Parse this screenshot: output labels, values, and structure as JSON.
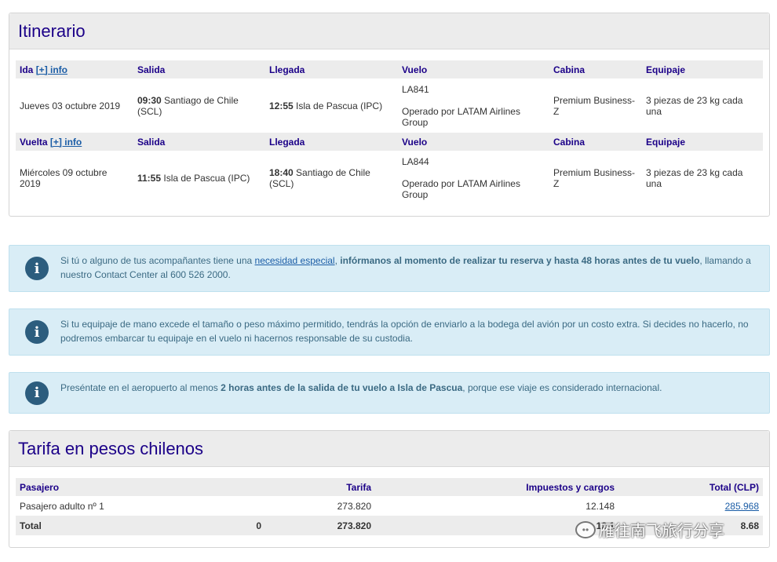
{
  "itinerary": {
    "title": "Itinerario",
    "headers": {
      "salida": "Salida",
      "llegada": "Llegada",
      "vuelo": "Vuelo",
      "cabina": "Cabina",
      "equipaje": "Equipaje"
    },
    "info_link": "[+] info",
    "ida": {
      "label": "Ida",
      "date": "Jueves 03 octubre 2019",
      "dep_time": "09:30",
      "dep_place": "Santiago de Chile (SCL)",
      "arr_time": "12:55",
      "arr_place": "Isla de Pascua (IPC)",
      "flight": "LA841",
      "operated": "Operado por LATAM Airlines Group",
      "cabin": "Premium Business-Z",
      "baggage": "3 piezas de 23 kg cada una"
    },
    "vuelta": {
      "label": "Vuelta",
      "date": "Miércoles 09 octubre 2019",
      "dep_time": "11:55",
      "dep_place": "Isla de Pascua (IPC)",
      "arr_time": "18:40",
      "arr_place": "Santiago de Chile (SCL)",
      "flight": "LA844",
      "operated": "Operado por LATAM Airlines Group",
      "cabin": "Premium Business-Z",
      "baggage": "3 piezas de 23 kg cada una"
    }
  },
  "alerts": {
    "icon": "info-icon",
    "a1": {
      "pre": "Si tú o alguno de tus acompañantes tiene una ",
      "link": "necesidad especial",
      "comma": ", ",
      "bold": "infórmanos al momento de realizar tu reserva y hasta 48 horas antes de tu vuelo",
      "post": ", llamando a nuestro Contact Center al 600 526 2000."
    },
    "a2": {
      "text": "Si tu equipaje de mano excede el tamaño o peso máximo permitido, tendrás la opción de enviarlo a la bodega del avión por un costo extra. Si decides no hacerlo, no podremos embarcar tu equipaje en el vuelo ni hacernos responsable de su custodia."
    },
    "a3": {
      "pre": "Preséntate en el aeropuerto al menos ",
      "bold": "2 horas antes de la salida de tu vuelo a Isla de Pascua",
      "post": ", porque ese viaje es considerado internacional."
    }
  },
  "fare": {
    "title": "Tarifa en pesos chilenos",
    "headers": {
      "pasajero": "Pasajero",
      "tarifa": "Tarifa",
      "impuestos": "Impuestos y cargos",
      "total": "Total (CLP)"
    },
    "row": {
      "pasajero": "Pasajero adulto nº 1",
      "tarifa": "273.820",
      "impuestos": "12.148",
      "total": "285.968"
    },
    "total_row": {
      "label": "Total",
      "count": "0",
      "tarifa": "273.820",
      "impuestos": "12.1",
      "total": "8.68"
    }
  },
  "watermark": {
    "text": "雁往南飞旅行分享"
  }
}
